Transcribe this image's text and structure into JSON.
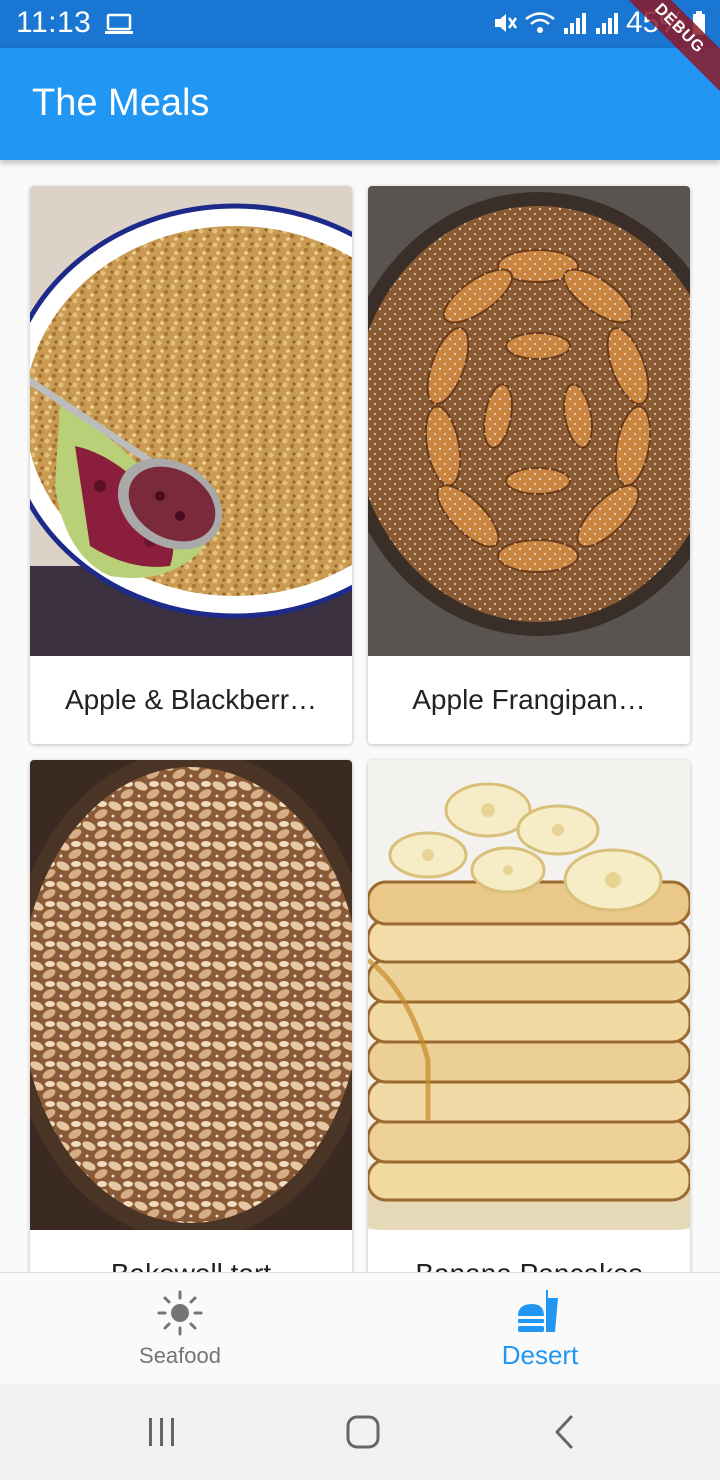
{
  "status_bar": {
    "time": "11:13",
    "battery": "45%",
    "debug_label": "DEBUG"
  },
  "app_bar": {
    "title": "The Meals"
  },
  "meals": [
    {
      "name": "Apple & Blackberr…",
      "image": "apple-blackberry-crumble-photo"
    },
    {
      "name": "Apple Frangipan…",
      "image": "apple-frangipane-tart-photo"
    },
    {
      "name": "Bakewell tart",
      "image": "bakewell-tart-photo"
    },
    {
      "name": "Banana Pancakes",
      "image": "banana-pancakes-photo"
    }
  ],
  "bottom_nav": {
    "items": [
      {
        "label": "Seafood",
        "icon": "sun-icon",
        "active": false
      },
      {
        "label": "Desert",
        "icon": "fastfood-icon",
        "active": true
      }
    ]
  },
  "colors": {
    "primary": "#2196F3",
    "primary_dark": "#1976D2",
    "inactive": "#757575"
  }
}
